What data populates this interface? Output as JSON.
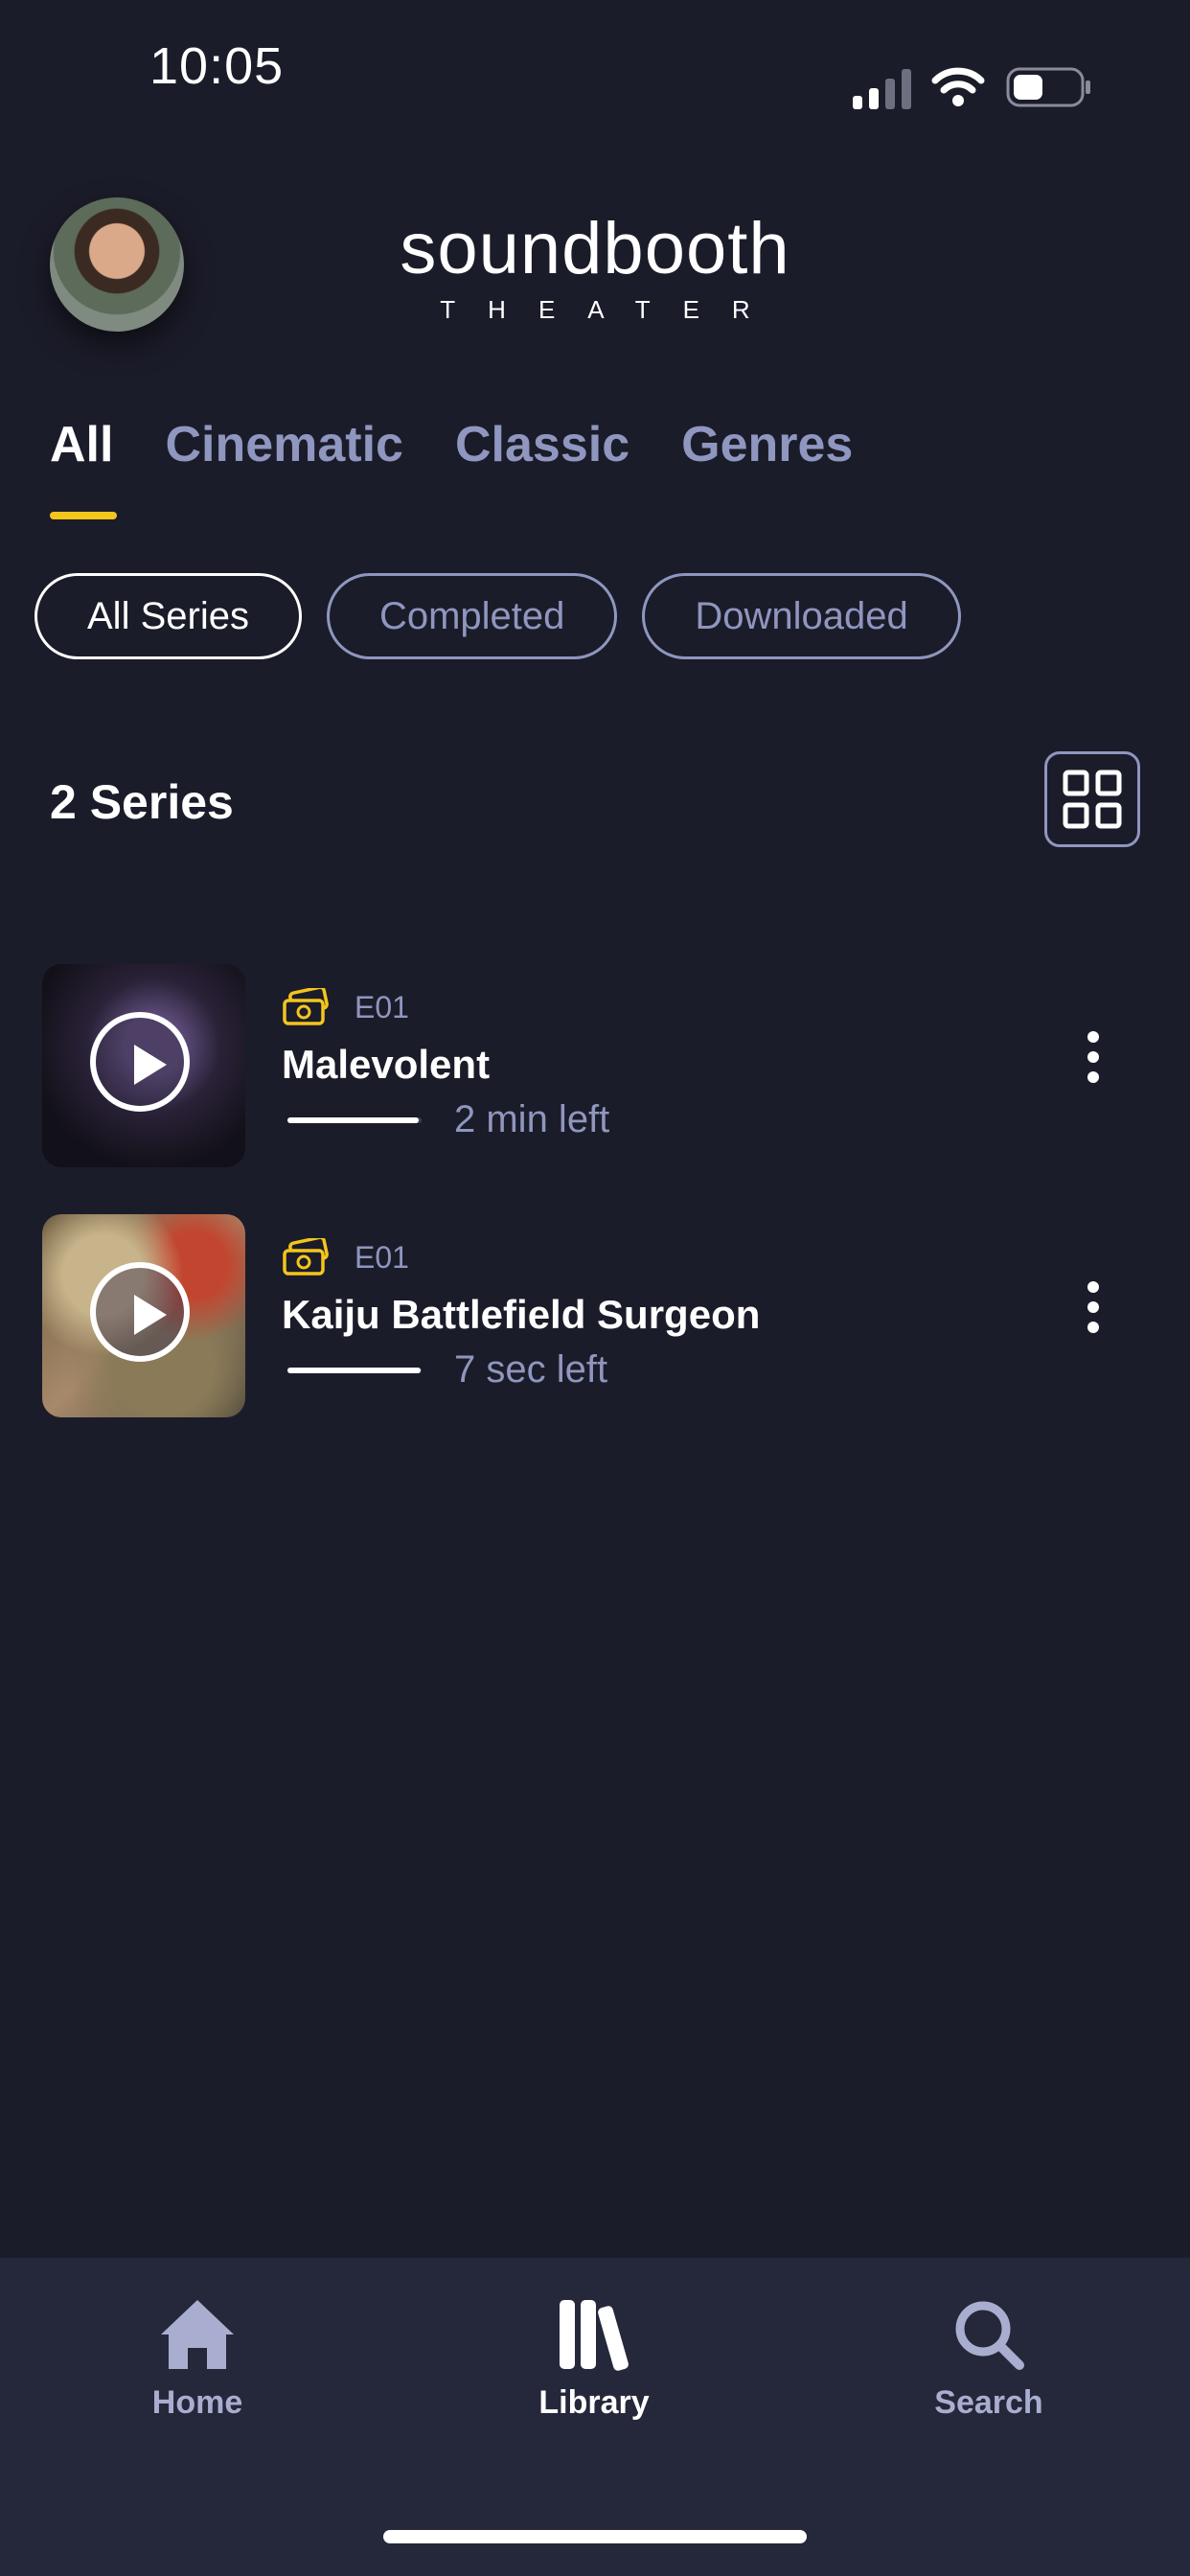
{
  "status_bar": {
    "time": "10:05"
  },
  "header": {
    "logo_main": "soundbooth",
    "logo_sub": "THEATER"
  },
  "tabs": [
    {
      "label": "All",
      "active": true
    },
    {
      "label": "Cinematic",
      "active": false
    },
    {
      "label": "Classic",
      "active": false
    },
    {
      "label": "Genres",
      "active": false
    }
  ],
  "filters": [
    {
      "label": "All Series",
      "active": true
    },
    {
      "label": "Completed",
      "active": false
    },
    {
      "label": "Downloaded",
      "active": false
    }
  ],
  "section": {
    "title": "2 Series",
    "view_toggle_icon": "grid-icon"
  },
  "series": [
    {
      "episode": "E01",
      "title": "Malevolent",
      "time_left": "2 min left",
      "progress": 0.98
    },
    {
      "episode": "E01",
      "title": "Kaiju Battlefield Surgeon",
      "time_left": "7 sec left",
      "progress": 0.99
    }
  ],
  "bottom_nav": [
    {
      "label": "Home",
      "icon": "home-icon",
      "active": false
    },
    {
      "label": "Library",
      "icon": "library-icon",
      "active": true
    },
    {
      "label": "Search",
      "icon": "search-icon",
      "active": false
    }
  ],
  "colors": {
    "background": "#1b1c29",
    "accent": "#f4c51d",
    "muted": "#8f96bf",
    "nav_bg": "#25283a"
  }
}
